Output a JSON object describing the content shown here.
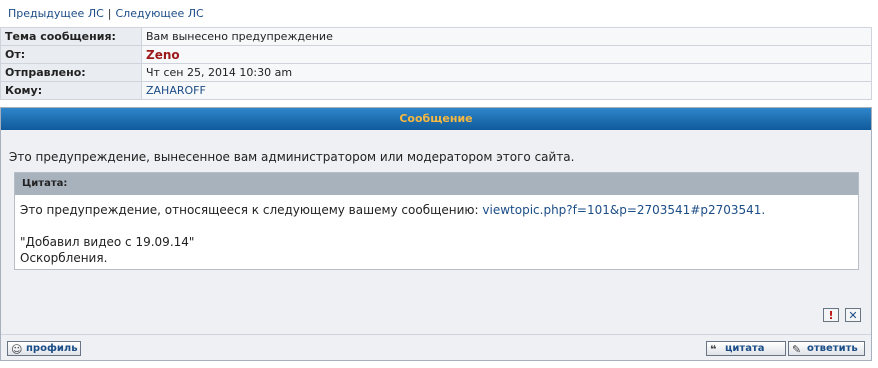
{
  "nav": {
    "prev_pm": "Предыдущее ЛС",
    "separator": "|",
    "next_pm": "Следующее ЛС"
  },
  "header": {
    "subject_label": "Тема сообщения:",
    "subject_value": "Вам вынесено предупреждение",
    "from_label": "От:",
    "from_value": "Zeno",
    "sent_label": "Отправлено:",
    "sent_value": "Чт сен 25, 2014 10:30 am",
    "to_label": "Кому:",
    "to_value": "ZAHAROFF"
  },
  "message": {
    "bar_title": "Сообщение",
    "intro": "Это предупреждение, вынесенное вам администратором или модератором этого сайта.",
    "quote": {
      "label": "Цитата:",
      "line1_prefix": "Это предупреждение, относящееся к следующему вашему сообщению: ",
      "line1_link": "viewtopic.php?f=101&p=2703541#p2703541.",
      "line2": "\"Добавил видео с 19.09.14\"",
      "line3": "Оскорбления."
    }
  },
  "icons": {
    "report": "!",
    "delete": "✕"
  },
  "buttons": {
    "profile": "профиль",
    "quote": "цитата",
    "reply": "ответить"
  },
  "colors": {
    "bar_gradient_top": "#2f86c9",
    "bar_gradient_bottom": "#0f5a9c",
    "bar_text": "#f5b840",
    "author": "#9c1a1a",
    "link": "#1b4d87"
  }
}
